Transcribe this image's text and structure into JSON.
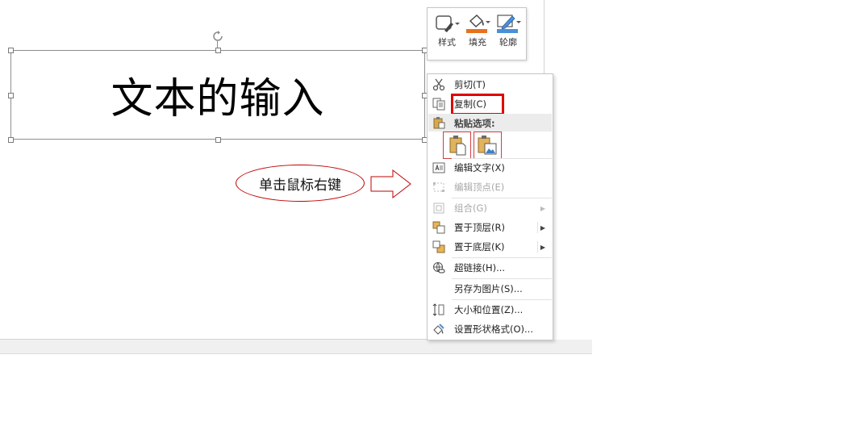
{
  "textbox": {
    "text": "文本的输入"
  },
  "annotation": {
    "text": "单击鼠标右键"
  },
  "mini_toolbar": {
    "buttons": [
      {
        "label": "样式",
        "icon": "shape-style-icon"
      },
      {
        "label": "填充",
        "icon": "fill-bucket-icon"
      },
      {
        "label": "轮廓",
        "icon": "outline-pen-icon"
      }
    ]
  },
  "context_menu": {
    "cut": "剪切(T)",
    "copy": "复制(C)",
    "paste_options_header": "粘贴选项:",
    "edit_text": "编辑文字(X)",
    "edit_points": "编辑顶点(E)",
    "group": "组合(G)",
    "bring_to_front": "置于顶层(R)",
    "send_to_back": "置于底层(K)",
    "hyperlink": "超链接(H)...",
    "save_as_picture": "另存为图片(S)...",
    "size_position": "大小和位置(Z)...",
    "format_shape": "设置形状格式(O)..."
  },
  "colors": {
    "highlight_red": "#e00000",
    "annotation_red": "#c00000",
    "fill_orange": "#e9711c",
    "outline_blue": "#4a90d9"
  }
}
